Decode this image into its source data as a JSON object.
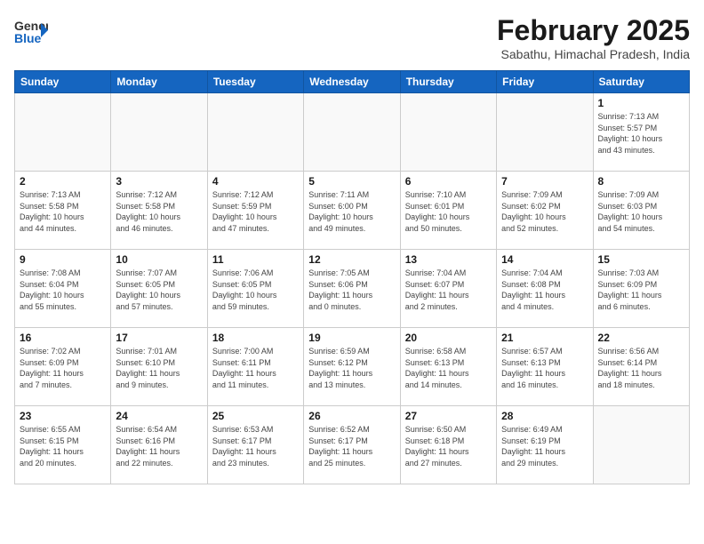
{
  "header": {
    "logo_general": "General",
    "logo_blue": "Blue",
    "month_title": "February 2025",
    "subtitle": "Sabathu, Himachal Pradesh, India"
  },
  "weekdays": [
    "Sunday",
    "Monday",
    "Tuesday",
    "Wednesday",
    "Thursday",
    "Friday",
    "Saturday"
  ],
  "weeks": [
    [
      {
        "day": "",
        "info": ""
      },
      {
        "day": "",
        "info": ""
      },
      {
        "day": "",
        "info": ""
      },
      {
        "day": "",
        "info": ""
      },
      {
        "day": "",
        "info": ""
      },
      {
        "day": "",
        "info": ""
      },
      {
        "day": "1",
        "info": "Sunrise: 7:13 AM\nSunset: 5:57 PM\nDaylight: 10 hours\nand 43 minutes."
      }
    ],
    [
      {
        "day": "2",
        "info": "Sunrise: 7:13 AM\nSunset: 5:58 PM\nDaylight: 10 hours\nand 44 minutes."
      },
      {
        "day": "3",
        "info": "Sunrise: 7:12 AM\nSunset: 5:58 PM\nDaylight: 10 hours\nand 46 minutes."
      },
      {
        "day": "4",
        "info": "Sunrise: 7:12 AM\nSunset: 5:59 PM\nDaylight: 10 hours\nand 47 minutes."
      },
      {
        "day": "5",
        "info": "Sunrise: 7:11 AM\nSunset: 6:00 PM\nDaylight: 10 hours\nand 49 minutes."
      },
      {
        "day": "6",
        "info": "Sunrise: 7:10 AM\nSunset: 6:01 PM\nDaylight: 10 hours\nand 50 minutes."
      },
      {
        "day": "7",
        "info": "Sunrise: 7:09 AM\nSunset: 6:02 PM\nDaylight: 10 hours\nand 52 minutes."
      },
      {
        "day": "8",
        "info": "Sunrise: 7:09 AM\nSunset: 6:03 PM\nDaylight: 10 hours\nand 54 minutes."
      }
    ],
    [
      {
        "day": "9",
        "info": "Sunrise: 7:08 AM\nSunset: 6:04 PM\nDaylight: 10 hours\nand 55 minutes."
      },
      {
        "day": "10",
        "info": "Sunrise: 7:07 AM\nSunset: 6:05 PM\nDaylight: 10 hours\nand 57 minutes."
      },
      {
        "day": "11",
        "info": "Sunrise: 7:06 AM\nSunset: 6:05 PM\nDaylight: 10 hours\nand 59 minutes."
      },
      {
        "day": "12",
        "info": "Sunrise: 7:05 AM\nSunset: 6:06 PM\nDaylight: 11 hours\nand 0 minutes."
      },
      {
        "day": "13",
        "info": "Sunrise: 7:04 AM\nSunset: 6:07 PM\nDaylight: 11 hours\nand 2 minutes."
      },
      {
        "day": "14",
        "info": "Sunrise: 7:04 AM\nSunset: 6:08 PM\nDaylight: 11 hours\nand 4 minutes."
      },
      {
        "day": "15",
        "info": "Sunrise: 7:03 AM\nSunset: 6:09 PM\nDaylight: 11 hours\nand 6 minutes."
      }
    ],
    [
      {
        "day": "16",
        "info": "Sunrise: 7:02 AM\nSunset: 6:09 PM\nDaylight: 11 hours\nand 7 minutes."
      },
      {
        "day": "17",
        "info": "Sunrise: 7:01 AM\nSunset: 6:10 PM\nDaylight: 11 hours\nand 9 minutes."
      },
      {
        "day": "18",
        "info": "Sunrise: 7:00 AM\nSunset: 6:11 PM\nDaylight: 11 hours\nand 11 minutes."
      },
      {
        "day": "19",
        "info": "Sunrise: 6:59 AM\nSunset: 6:12 PM\nDaylight: 11 hours\nand 13 minutes."
      },
      {
        "day": "20",
        "info": "Sunrise: 6:58 AM\nSunset: 6:13 PM\nDaylight: 11 hours\nand 14 minutes."
      },
      {
        "day": "21",
        "info": "Sunrise: 6:57 AM\nSunset: 6:13 PM\nDaylight: 11 hours\nand 16 minutes."
      },
      {
        "day": "22",
        "info": "Sunrise: 6:56 AM\nSunset: 6:14 PM\nDaylight: 11 hours\nand 18 minutes."
      }
    ],
    [
      {
        "day": "23",
        "info": "Sunrise: 6:55 AM\nSunset: 6:15 PM\nDaylight: 11 hours\nand 20 minutes."
      },
      {
        "day": "24",
        "info": "Sunrise: 6:54 AM\nSunset: 6:16 PM\nDaylight: 11 hours\nand 22 minutes."
      },
      {
        "day": "25",
        "info": "Sunrise: 6:53 AM\nSunset: 6:17 PM\nDaylight: 11 hours\nand 23 minutes."
      },
      {
        "day": "26",
        "info": "Sunrise: 6:52 AM\nSunset: 6:17 PM\nDaylight: 11 hours\nand 25 minutes."
      },
      {
        "day": "27",
        "info": "Sunrise: 6:50 AM\nSunset: 6:18 PM\nDaylight: 11 hours\nand 27 minutes."
      },
      {
        "day": "28",
        "info": "Sunrise: 6:49 AM\nSunset: 6:19 PM\nDaylight: 11 hours\nand 29 minutes."
      },
      {
        "day": "",
        "info": ""
      }
    ]
  ]
}
